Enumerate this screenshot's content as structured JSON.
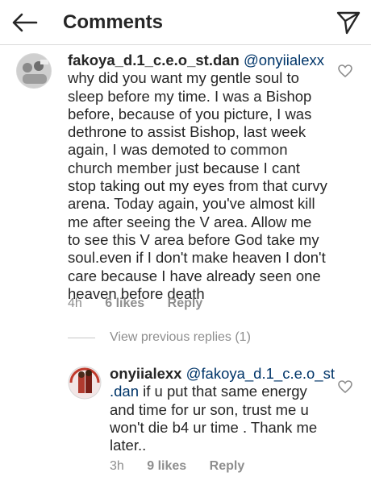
{
  "header": {
    "title": "Comments",
    "back_icon": "arrow-left-icon",
    "send_icon": "paper-plane-icon"
  },
  "comments": [
    {
      "username": "fakoya_d.1_c.e.o_st.dan",
      "mention": "@onyiialexx",
      "lines": [
        "why did you want my gentle soul to",
        "sleep before my time. I was a Bishop",
        "before, because of you picture, I was",
        "dethrone to assist Bishop, last week",
        "again, I was demoted to common",
        "church member just because I cant",
        "stop taking out my eyes from that curvy",
        "arena. Today again, you've almost kill",
        "me after seeing the V area. Allow me",
        "to see this V area before God take my",
        "soul.even if I don't make heaven I don't",
        "care because I have already seen one",
        "heaven before death"
      ],
      "time": "4h",
      "likes": "6 likes",
      "reply": "Reply"
    },
    {
      "username": "onyiialexx",
      "mention_line1": "@fakoya_d.1_c.e.o_st",
      "mention_line2": ".dan",
      "lines": [
        " if u put that same energy",
        "and time for ur son, trust me u",
        "won't die b4 ur time . Thank me",
        "later.."
      ],
      "time": "3h",
      "likes": "9 likes",
      "reply": "Reply"
    }
  ],
  "view_replies": "View previous replies (1)",
  "colors": {
    "text": "#262626",
    "secondary": "#8e8e8e",
    "mention": "#003569",
    "divider": "#dbdbdb"
  }
}
